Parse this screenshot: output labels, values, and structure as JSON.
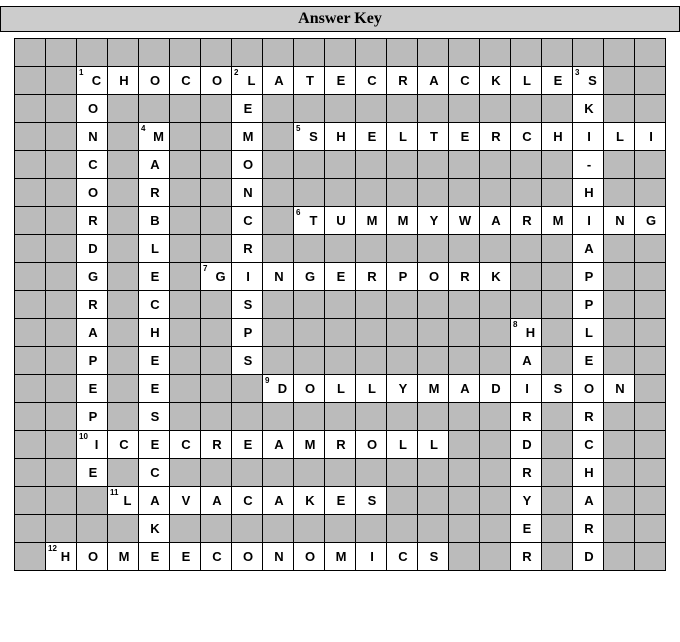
{
  "title": "Answer Key",
  "grid": {
    "rows": 21,
    "cols": 21
  },
  "chart_data": {
    "type": "table",
    "description": "Crossword answer key grid 21x21; null = blocked/grey cell",
    "letters": [
      [
        null,
        null,
        null,
        null,
        null,
        null,
        null,
        null,
        null,
        null,
        null,
        null,
        null,
        null,
        null,
        null,
        null,
        null,
        null,
        null,
        null
      ],
      [
        null,
        null,
        "C",
        "H",
        "O",
        "C",
        "O",
        "L",
        "A",
        "T",
        "E",
        "C",
        "R",
        "A",
        "C",
        "K",
        "L",
        "E",
        "S",
        null,
        null
      ],
      [
        null,
        null,
        "O",
        null,
        null,
        null,
        null,
        "E",
        null,
        null,
        null,
        null,
        null,
        null,
        null,
        null,
        null,
        null,
        "K",
        null,
        null
      ],
      [
        null,
        null,
        "N",
        null,
        "M",
        null,
        null,
        "M",
        null,
        "S",
        "H",
        "E",
        "L",
        "T",
        "E",
        "R",
        "C",
        "H",
        "I",
        "L",
        "I"
      ],
      [
        null,
        null,
        "C",
        null,
        "A",
        null,
        null,
        "O",
        null,
        null,
        null,
        null,
        null,
        null,
        null,
        null,
        null,
        null,
        "-",
        null,
        null
      ],
      [
        null,
        null,
        "O",
        null,
        "R",
        null,
        null,
        "N",
        null,
        null,
        null,
        null,
        null,
        null,
        null,
        null,
        null,
        null,
        "H",
        null,
        null
      ],
      [
        null,
        null,
        "R",
        null,
        "B",
        null,
        null,
        "C",
        null,
        "T",
        "U",
        "M",
        "M",
        "Y",
        "W",
        "A",
        "R",
        "M",
        "I",
        "N",
        "G"
      ],
      [
        null,
        null,
        "D",
        null,
        "L",
        null,
        null,
        "R",
        null,
        null,
        null,
        null,
        null,
        null,
        null,
        null,
        null,
        null,
        "A",
        null,
        null
      ],
      [
        null,
        null,
        "G",
        null,
        "E",
        null,
        "G",
        "I",
        "N",
        "G",
        "E",
        "R",
        "P",
        "O",
        "R",
        "K",
        null,
        null,
        "P",
        null,
        null
      ],
      [
        null,
        null,
        "R",
        null,
        "C",
        null,
        null,
        "S",
        null,
        null,
        null,
        null,
        null,
        null,
        null,
        null,
        null,
        null,
        "P",
        null,
        null
      ],
      [
        null,
        null,
        "A",
        null,
        "H",
        null,
        null,
        "P",
        null,
        null,
        null,
        null,
        null,
        null,
        null,
        null,
        "H",
        null,
        "L",
        null,
        null
      ],
      [
        null,
        null,
        "P",
        null,
        "E",
        null,
        null,
        "S",
        null,
        null,
        null,
        null,
        null,
        null,
        null,
        null,
        "A",
        null,
        "E",
        null,
        null
      ],
      [
        null,
        null,
        "E",
        null,
        "E",
        null,
        null,
        null,
        "D",
        "O",
        "L",
        "L",
        "Y",
        "M",
        "A",
        "D",
        "I",
        "S",
        "O",
        "N",
        null
      ],
      [
        null,
        null,
        "P",
        null,
        "S",
        null,
        null,
        null,
        null,
        null,
        null,
        null,
        null,
        null,
        null,
        null,
        "R",
        null,
        "R",
        null,
        null
      ],
      [
        null,
        null,
        "I",
        "C",
        "E",
        "C",
        "R",
        "E",
        "A",
        "M",
        "R",
        "O",
        "L",
        "L",
        null,
        null,
        "D",
        null,
        "C",
        null,
        null
      ],
      [
        null,
        null,
        "E",
        null,
        "C",
        null,
        null,
        null,
        null,
        null,
        null,
        null,
        null,
        null,
        null,
        null,
        "R",
        null,
        "H",
        null,
        null
      ],
      [
        null,
        null,
        null,
        "L",
        "A",
        "V",
        "A",
        "C",
        "A",
        "K",
        "E",
        "S",
        null,
        null,
        null,
        null,
        "Y",
        null,
        "A",
        null,
        null
      ],
      [
        null,
        null,
        null,
        null,
        "K",
        null,
        null,
        null,
        null,
        null,
        null,
        null,
        null,
        null,
        null,
        null,
        "E",
        null,
        "R",
        null,
        null
      ],
      [
        null,
        "H",
        "O",
        "M",
        "E",
        "E",
        "C",
        "O",
        "N",
        "O",
        "M",
        "I",
        "C",
        "S",
        null,
        null,
        "R",
        null,
        "D",
        null,
        null
      ],
      [
        null,
        null,
        null,
        null,
        null,
        null,
        null,
        null,
        null,
        null,
        null,
        null,
        null,
        null,
        null,
        null,
        null,
        null,
        null,
        null,
        null
      ],
      [
        null,
        null,
        null,
        null,
        null,
        null,
        null,
        null,
        null,
        null,
        null,
        null,
        null,
        null,
        null,
        null,
        null,
        null,
        null,
        null,
        null
      ]
    ],
    "numbers": {
      "1,2": 1,
      "1,7": 2,
      "1,18": 3,
      "3,4": 4,
      "3,9": 5,
      "6,9": 6,
      "8,6": 7,
      "10,16": 8,
      "12,8": 9,
      "14,2": 10,
      "16,3": 11,
      "18,1": 12
    }
  }
}
